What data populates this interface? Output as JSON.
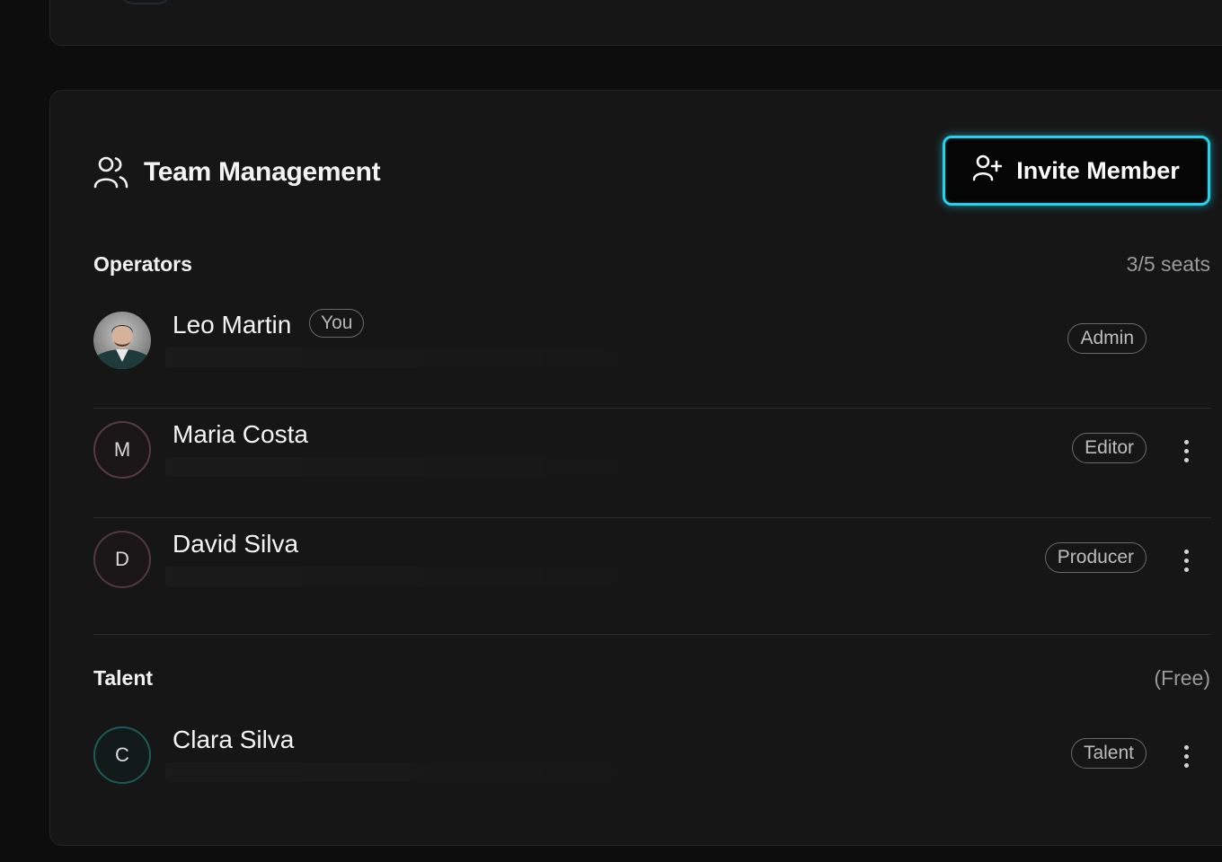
{
  "header": {
    "title": "Team Management",
    "icon": "users-icon"
  },
  "invite_button": {
    "label": "Invite Member",
    "icon": "user-plus-icon"
  },
  "operators": {
    "label": "Operators",
    "meta": "3/5 seats",
    "members": [
      {
        "name": "Leo Martin",
        "you_badge": "You",
        "role": "Admin",
        "avatar": "photo"
      },
      {
        "name": "Maria Costa",
        "initial": "M",
        "role": "Editor"
      },
      {
        "name": "David Silva",
        "initial": "D",
        "role": "Producer"
      }
    ]
  },
  "talent": {
    "label": "Talent",
    "meta": "(Free)",
    "members": [
      {
        "name": "Clara Silva",
        "initial": "C",
        "role": "Talent"
      }
    ]
  },
  "colors": {
    "accent": "#22d3ee",
    "card_bg": "#161616",
    "page_bg": "#0d0d0d"
  }
}
